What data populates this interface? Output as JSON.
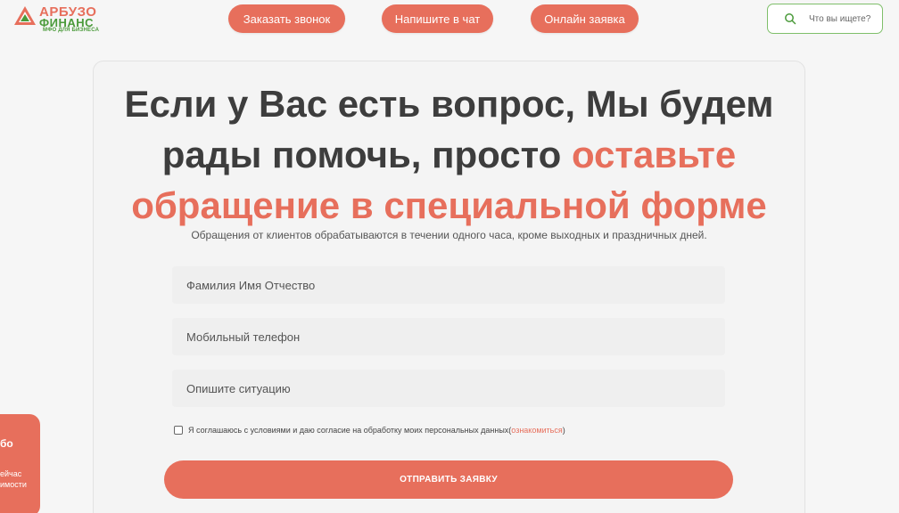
{
  "logo": {
    "line1": "АРБУЗО",
    "line2": "ФИНАНС",
    "line3": "МФО ДЛЯ БИЗНЕСА"
  },
  "nav": {
    "call_label": "Заказать звонок",
    "chat_label": "Напишите в чат",
    "online_label": "Онлайн заявка"
  },
  "search": {
    "placeholder": "Что вы ищете?"
  },
  "headline": {
    "part1": "Если у Вас есть вопрос, Мы будем рады помочь, просто ",
    "accent": "оставьте обращение в специальной форме"
  },
  "subtext": "Обращения от клиентов обрабатываются в течении одного часа, кроме выходных и праздничных дней.",
  "form": {
    "name_placeholder": "Фамилия Имя Отчество",
    "phone_placeholder": "Мобильный телефон",
    "situation_placeholder": "Опишите ситуацию",
    "consent_text": "Я соглашаюсь с условиями и даю согласие на обработку моих персональных данных ",
    "consent_open": "(",
    "consent_link": "ознакомиться",
    "consent_close": ")",
    "submit_label": "ОТПРАВИТЬ ЗАЯВКУ"
  },
  "side_widget": {
    "line1": "бо",
    "line2": "ейчас",
    "line3": "имости"
  },
  "colors": {
    "accent": "#e76f5c",
    "brand_green": "#4a9a3a",
    "background": "#f6f6f6"
  }
}
